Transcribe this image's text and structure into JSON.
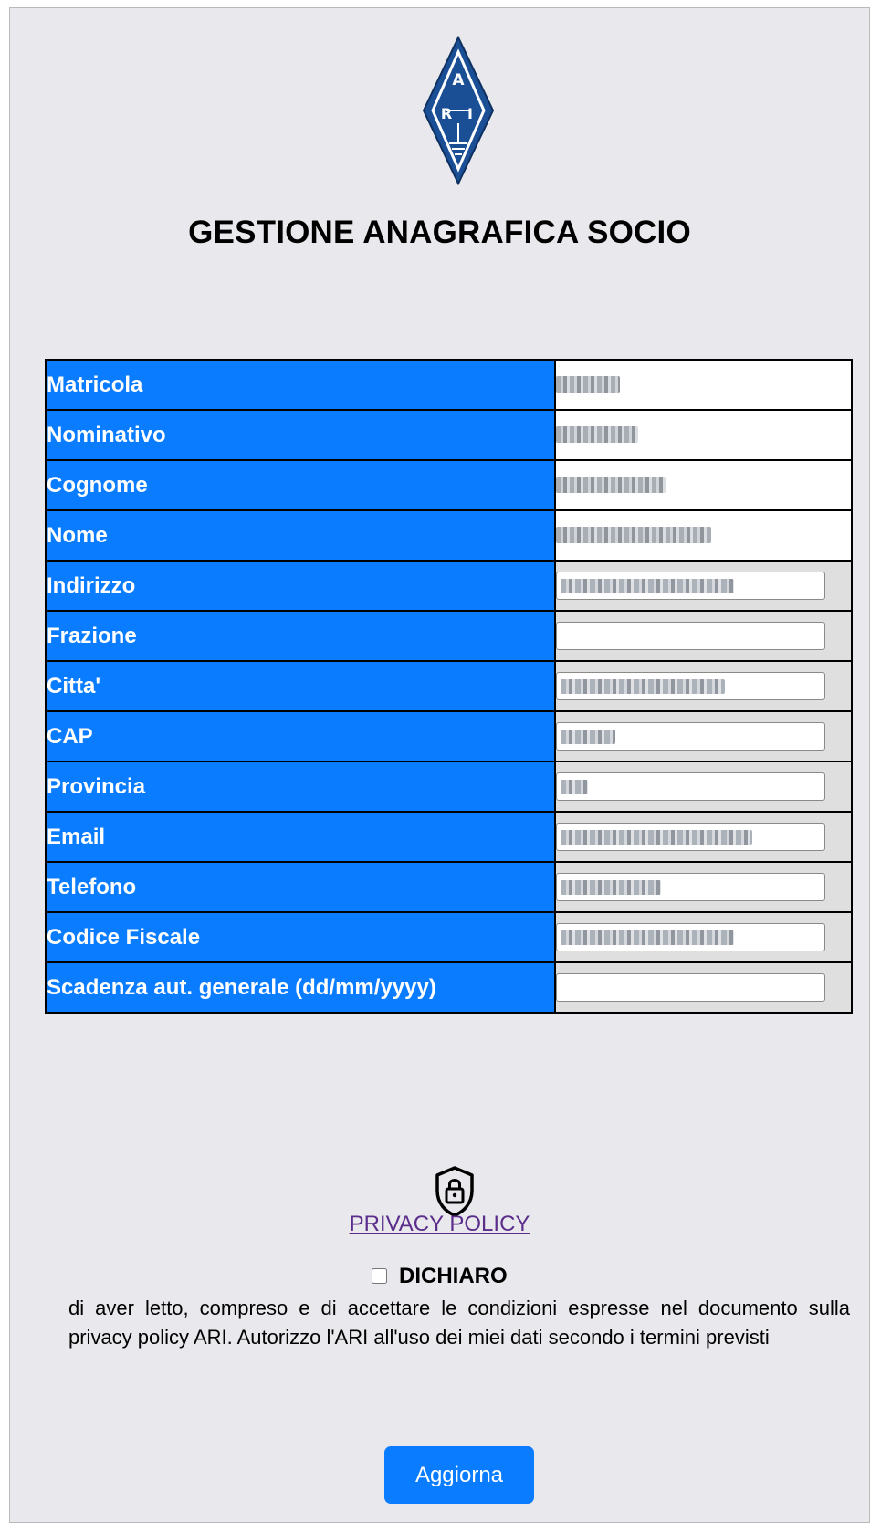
{
  "header": {
    "logo": {
      "icon": "ari-diamond-logo",
      "text": "ARI"
    },
    "title": "GESTIONE ANAGRAFICA SOCIO"
  },
  "form": {
    "rows": [
      {
        "label": "Matricola",
        "type": "readonly"
      },
      {
        "label": "Nominativo",
        "type": "readonly"
      },
      {
        "label": "Cognome",
        "type": "readonly"
      },
      {
        "label": "Nome",
        "type": "readonly"
      },
      {
        "label": "Indirizzo",
        "type": "input"
      },
      {
        "label": "Frazione",
        "type": "input"
      },
      {
        "label": "Citta'",
        "type": "input"
      },
      {
        "label": "CAP",
        "type": "input"
      },
      {
        "label": "Provincia",
        "type": "input"
      },
      {
        "label": "Email",
        "type": "input"
      },
      {
        "label": "Telefono",
        "type": "input"
      },
      {
        "label": "Codice Fiscale",
        "type": "input"
      },
      {
        "label": "Scadenza aut. generale (dd/mm/yyyy)",
        "type": "input"
      }
    ]
  },
  "privacy": {
    "icon": "shield-lock-icon",
    "link_label": "PRIVACY POLICY",
    "checkbox_label": "DICHIARO",
    "checked": false,
    "text": "di aver letto, compreso e di accettare le condizioni espresse nel documento sulla privacy policy ARI. Autorizzo l'ARI all'uso dei miei dati secondo i termini previsti"
  },
  "actions": {
    "submit_label": "Aggiorna"
  },
  "colors": {
    "accent": "#0a7cff",
    "background": "#e9e8ec",
    "link": "#5b2e8c"
  }
}
